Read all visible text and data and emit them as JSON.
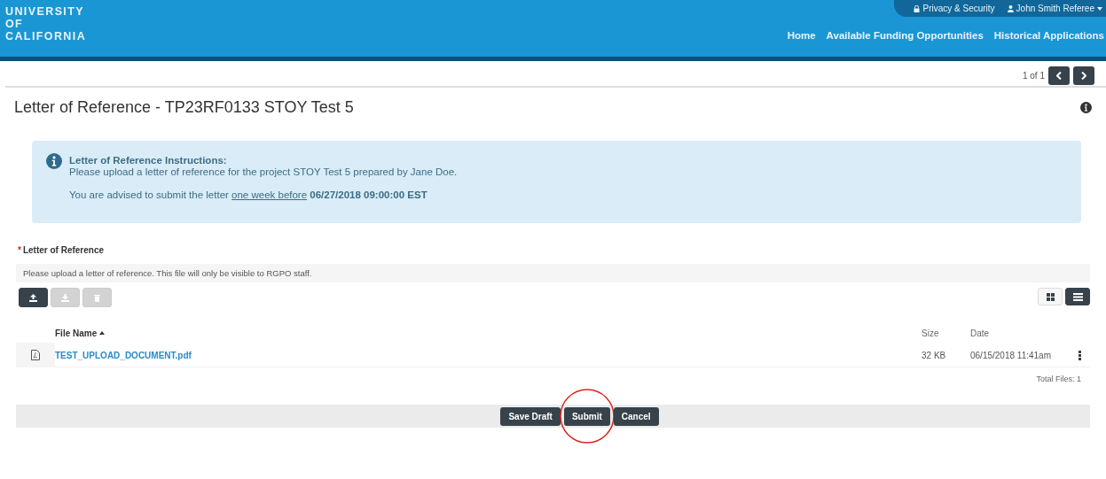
{
  "header": {
    "logo_lines": [
      "UNIVERSITY",
      "OF",
      "CALIFORNIA"
    ],
    "utility_links": [
      {
        "kind": "lock",
        "label": "Privacy & Security"
      },
      {
        "kind": "user",
        "label": "John Smith Referee"
      }
    ],
    "nav": [
      "Home",
      "Available Funding Opportunities",
      "Historical Applications"
    ]
  },
  "pager": {
    "text": "1 of 1"
  },
  "page_title": "Letter of Reference - TP23RF0133 STOY Test 5",
  "instructions": {
    "title": "Letter of Reference Instructions:",
    "body": "Please upload a letter of reference for the project STOY Test 5 prepared by Jane Doe.",
    "advice_before": "You are advised to submit the letter",
    "advice_link": "one week before",
    "advice_deadline": "06/27/2018 09:00:00 EST"
  },
  "field": {
    "label": "Letter of Reference",
    "required_mark": "*",
    "help": "Please upload a letter of reference. This file will only be visible to RGPO staff."
  },
  "file_tools": [
    {
      "kind": "upload",
      "disabled": false
    },
    {
      "kind": "download",
      "disabled": true
    },
    {
      "kind": "delete",
      "disabled": true
    }
  ],
  "views": [
    {
      "kind": "grid",
      "selected": false
    },
    {
      "kind": "list",
      "selected": true
    }
  ],
  "table": {
    "columns": [
      "File Name",
      "Size",
      "Date"
    ],
    "rows": [
      {
        "name": "TEST_UPLOAD_DOCUMENT.pdf",
        "size": "32 KB",
        "date": "06/15/2018 11:41am"
      }
    ],
    "total": "Total Files: 1"
  },
  "actions": [
    {
      "label": "Save Draft",
      "circled": false
    },
    {
      "label": "Submit",
      "circled": true
    },
    {
      "label": "Cancel",
      "circled": false
    }
  ]
}
